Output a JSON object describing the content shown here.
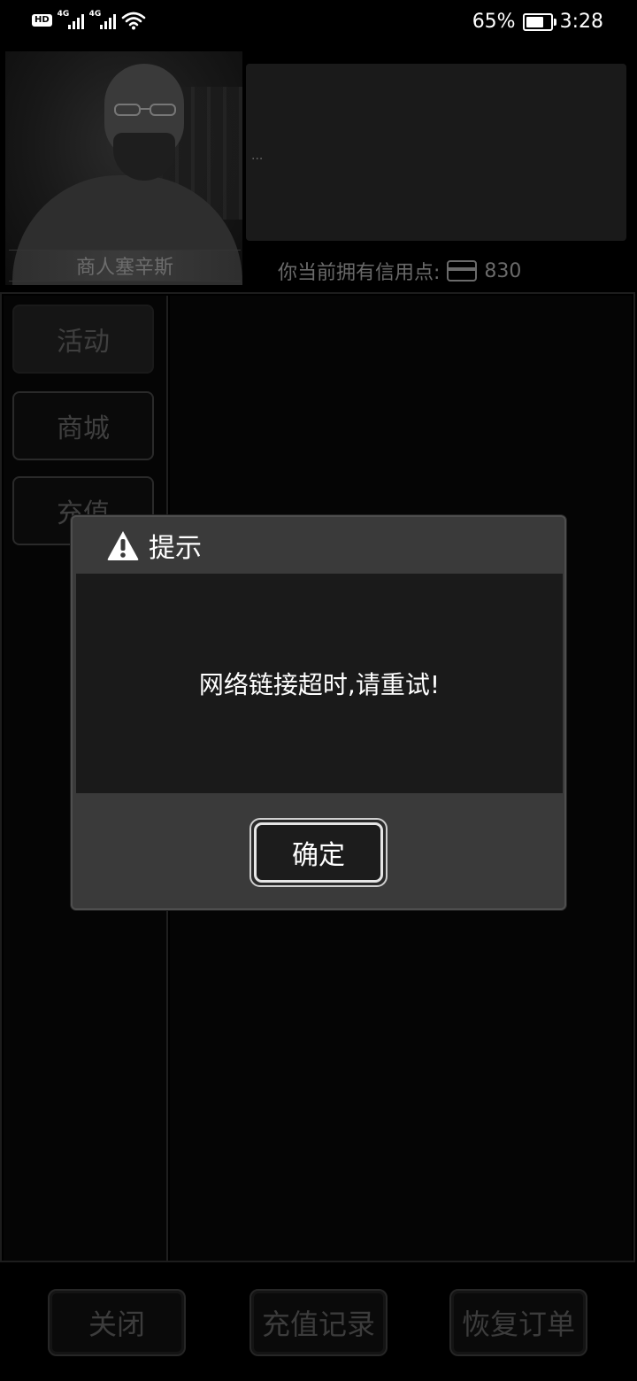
{
  "status_bar": {
    "hd_label": "HD",
    "sim1_label": "4G",
    "sim2_label": "4G",
    "battery_percent": "65%",
    "time": "3:28"
  },
  "merchant": {
    "name": "商人塞辛斯",
    "speech": "..."
  },
  "credits": {
    "label": "你当前拥有信用点:",
    "value": "830"
  },
  "sidebar": {
    "items": [
      {
        "label": "活动"
      },
      {
        "label": "商城"
      },
      {
        "label": "充值"
      }
    ]
  },
  "footer": {
    "close_label": "关闭",
    "recharge_history_label": "充值记录",
    "restore_orders_label": "恢复订单"
  },
  "dialog": {
    "title": "提示",
    "message": "网络链接超时,请重试!",
    "confirm_label": "确定"
  }
}
